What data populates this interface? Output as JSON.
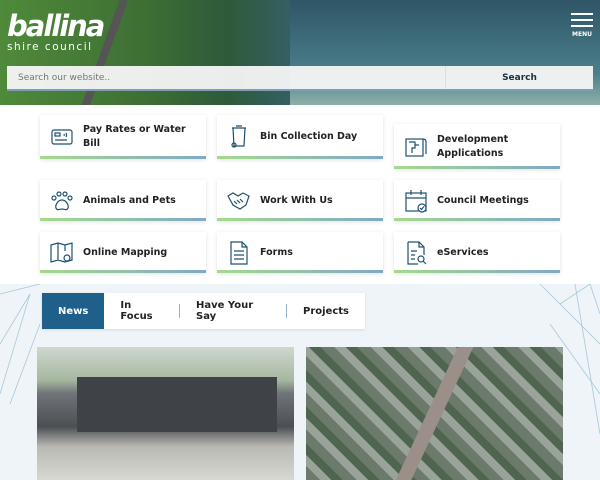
{
  "header": {
    "logo_main": "ballina",
    "logo_sub": "shire council",
    "menu_label": "MENU"
  },
  "search": {
    "placeholder": "Search our website..",
    "button": "Search"
  },
  "quick_links": [
    {
      "label": "Pay Rates or Water Bill",
      "icon": "credit-card-icon"
    },
    {
      "label": "Bin Collection Day",
      "icon": "wheelie-bin-icon"
    },
    {
      "label": "Development Applications",
      "icon": "blueprint-icon"
    },
    {
      "label": "Animals and Pets",
      "icon": "paw-icon"
    },
    {
      "label": "Work With Us",
      "icon": "handshake-icon"
    },
    {
      "label": "Council Meetings",
      "icon": "calendar-check-icon"
    },
    {
      "label": "Online Mapping",
      "icon": "map-pin-icon"
    },
    {
      "label": "Forms",
      "icon": "document-icon"
    },
    {
      "label": "eServices",
      "icon": "document-search-icon"
    }
  ],
  "tabs": [
    "News",
    "In Focus",
    "Have Your Say",
    "Projects"
  ],
  "colors": {
    "accent": "#1f5f8b",
    "icon": "#1f5070"
  }
}
